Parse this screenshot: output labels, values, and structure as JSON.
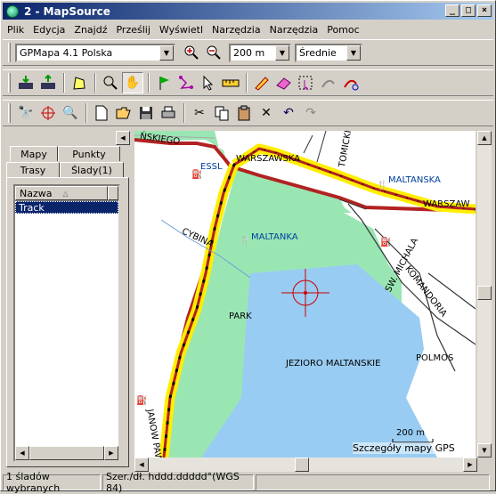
{
  "window": {
    "title": "2 - MapSource"
  },
  "menu": [
    "Plik",
    "Edycja",
    "Znajdź",
    "Prześlij",
    "Wyświetl",
    "Narzędzia",
    "Narzędzia",
    "Pomoc"
  ],
  "toolbar1": {
    "map_product": "GPMapa 4.1 Polska",
    "zoom_value": "200 m",
    "detail_level": "Średnie"
  },
  "panel": {
    "tabs_top": [
      "Mapy",
      "Punkty"
    ],
    "tabs_bottom": [
      "Trasy",
      "Ślady(1)"
    ],
    "column": "Nazwa",
    "tracks": [
      "Track"
    ]
  },
  "map": {
    "labels": {
      "street_top": "ŃSKIEGO",
      "warszawska": "WARSZAWSKA",
      "warszaw_right": "WARSZAW",
      "tomickie": "TOMICKIE",
      "essl": "ESSL",
      "maltanska": "MALTANSKA",
      "cybina": "CYBINA",
      "maltanka": "MALTANKA",
      "park": "PARK",
      "jezioro": "JEZIORO MALTANSKIE",
      "polmos": "POLMOS",
      "michala": "SW. MICHALA",
      "komandoria": "KOMANDORIA",
      "janow": "JANOW PAW",
      "scale": "200 m",
      "detail_note": "Szczegóły mapy GPS"
    },
    "colors": {
      "park": "#99e6b3",
      "lake": "#99ccf2",
      "road_red": "#b22222",
      "track_yellow": "#ffee00"
    }
  },
  "status": {
    "selection": "1 śladów wybranych",
    "coords": "Szer./dł. hddd.ddddd°(WGS 84)"
  }
}
